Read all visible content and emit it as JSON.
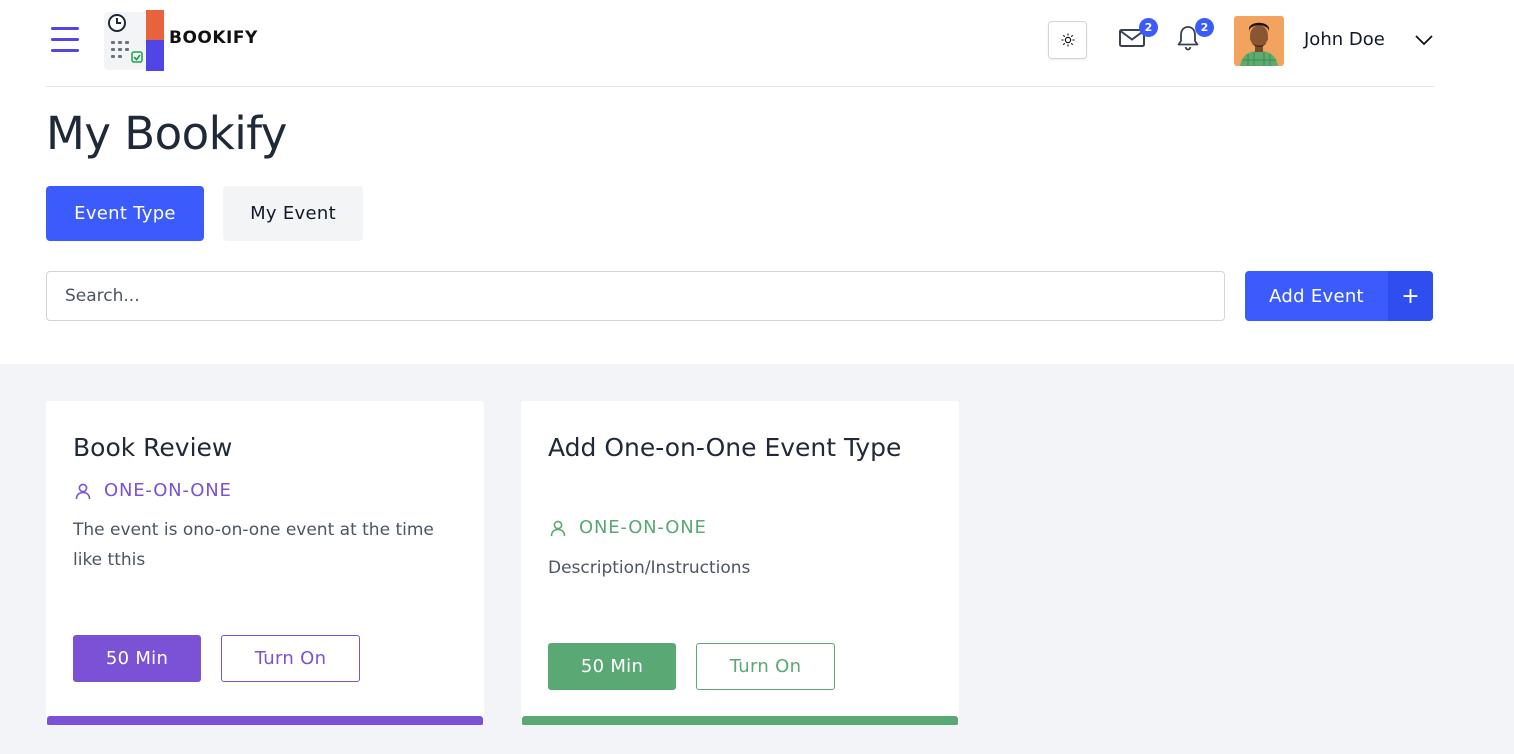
{
  "brand": {
    "name": "BOOKIFY"
  },
  "header": {
    "theme_icon": "sun-icon",
    "mail": {
      "icon": "mail-icon",
      "count": "2"
    },
    "notifications": {
      "icon": "bell-icon",
      "count": "2"
    },
    "user": {
      "name": "John Doe"
    }
  },
  "page": {
    "title": "My Bookify"
  },
  "tabs": [
    {
      "label": "Event Type",
      "active": true
    },
    {
      "label": "My Event",
      "active": false
    }
  ],
  "search": {
    "placeholder": "Search..."
  },
  "add_event": {
    "label": "Add Event",
    "icon_glyph": "+"
  },
  "colors": {
    "primary": "#3b5bfd",
    "purple": "#7b52d6",
    "green": "#5aa873"
  },
  "cards": [
    {
      "title": "Book Review",
      "type": "ONE-ON-ONE",
      "description": "The event is ono-on-one event at the time like tthis",
      "duration": "50 Min",
      "toggle": "Turn On",
      "color": "#7b52d6"
    },
    {
      "title": "Add One-on-One Event Type",
      "type": "ONE-ON-ONE",
      "description": "Description/Instructions",
      "duration": "50 Min",
      "toggle": "Turn On",
      "color": "#5aa873"
    }
  ]
}
